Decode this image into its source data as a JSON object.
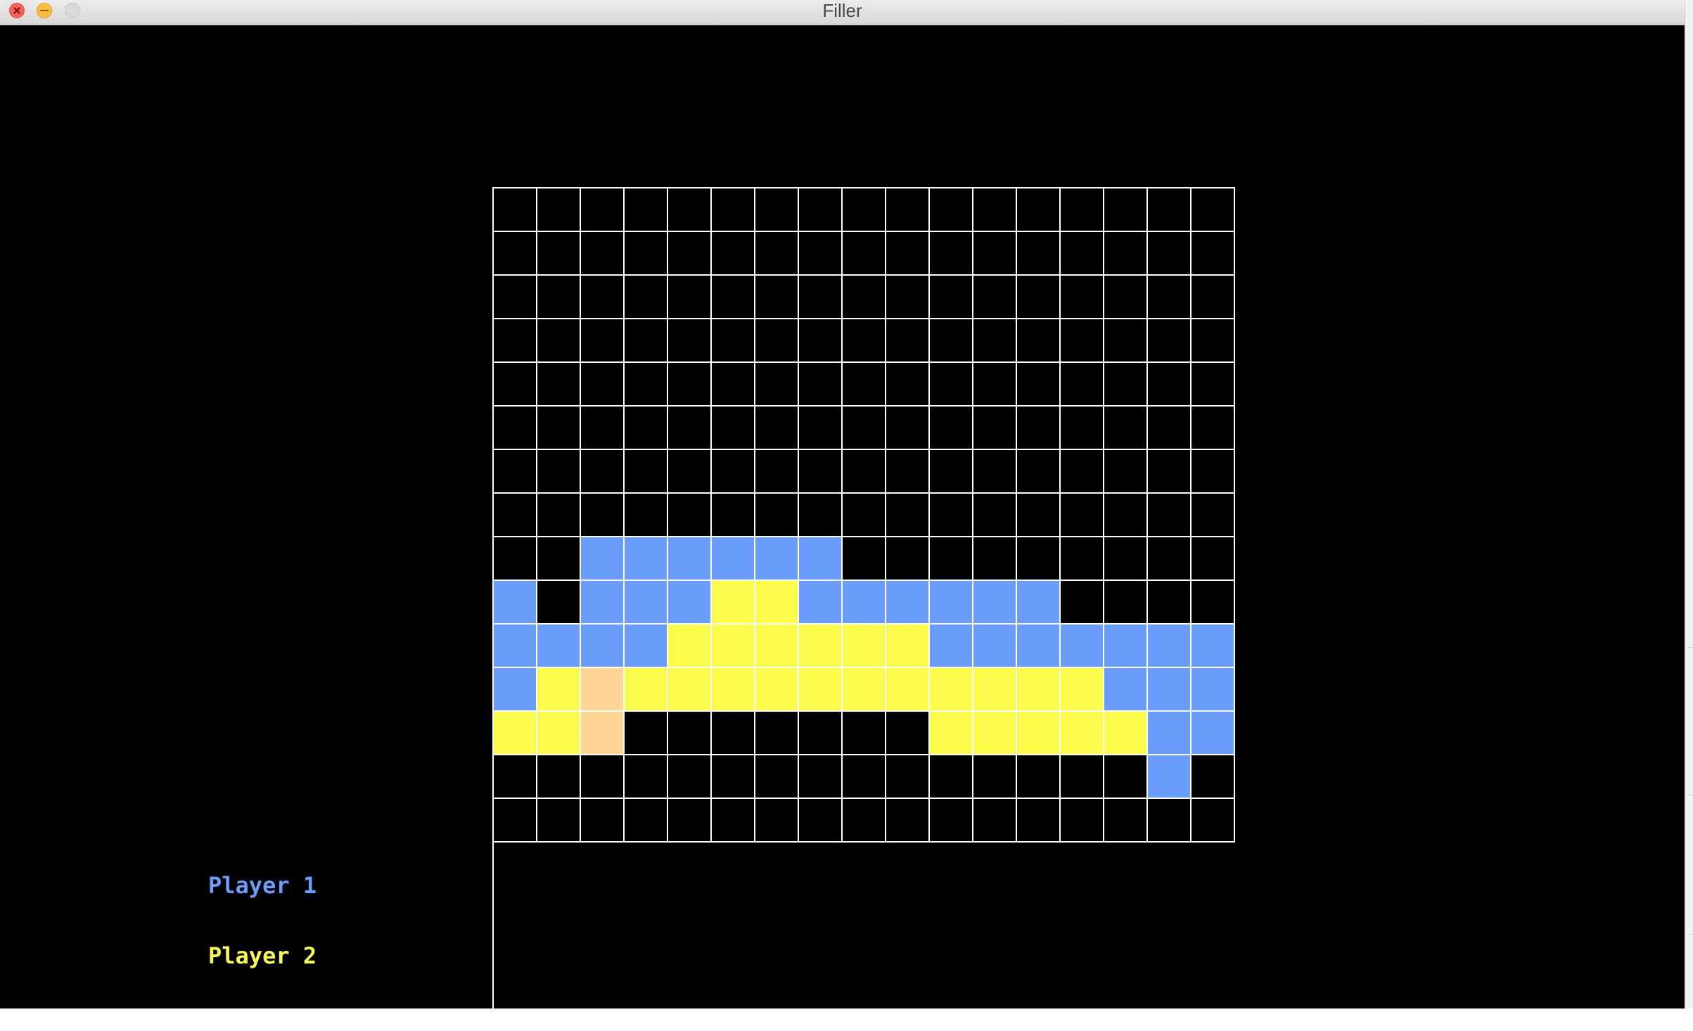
{
  "window": {
    "title": "Filler"
  },
  "colors": {
    "background": "#000000",
    "grid_line": "#ffffff",
    "player1": "#6a9cfc",
    "player2": "#fbfb4b",
    "last_piece": "#fdd695"
  },
  "players": [
    {
      "label": "Player 1",
      "color": "#6a9cfc"
    },
    {
      "label": "Player 2",
      "color": "#fbfb4b"
    }
  ],
  "board": {
    "columns": 17,
    "rows": [
      ".................",
      ".................",
      ".................",
      ".................",
      ".................",
      ".................",
      ".................",
      ".................",
      "..OOOOOO.........",
      "O.OOOXXOOOOOO....",
      "OOOOXXXXXXOOOOOOO",
      "OX*XXXXXXXXXXXOOO",
      "XX*.......XXXXXOO",
      "...............O.",
      "................."
    ],
    "legend": {
      ".": "empty",
      "O": "player1",
      "X": "player2",
      "*": "last_piece"
    }
  }
}
